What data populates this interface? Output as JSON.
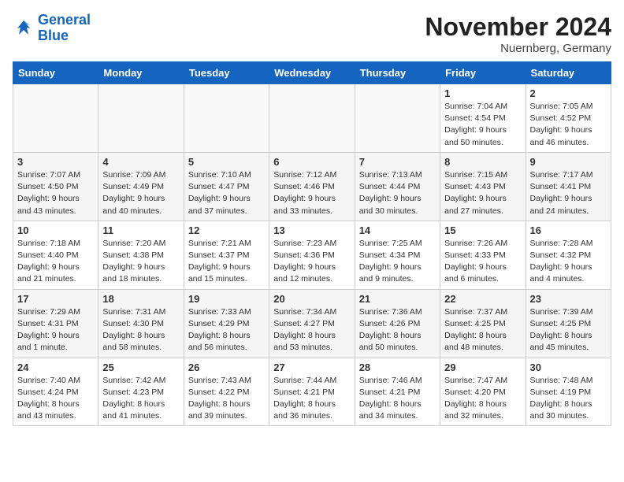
{
  "header": {
    "logo_line1": "General",
    "logo_line2": "Blue",
    "month_title": "November 2024",
    "location": "Nuernberg, Germany"
  },
  "weekdays": [
    "Sunday",
    "Monday",
    "Tuesday",
    "Wednesday",
    "Thursday",
    "Friday",
    "Saturday"
  ],
  "weeks": [
    [
      {
        "day": "",
        "info": ""
      },
      {
        "day": "",
        "info": ""
      },
      {
        "day": "",
        "info": ""
      },
      {
        "day": "",
        "info": ""
      },
      {
        "day": "",
        "info": ""
      },
      {
        "day": "1",
        "info": "Sunrise: 7:04 AM\nSunset: 4:54 PM\nDaylight: 9 hours\nand 50 minutes."
      },
      {
        "day": "2",
        "info": "Sunrise: 7:05 AM\nSunset: 4:52 PM\nDaylight: 9 hours\nand 46 minutes."
      }
    ],
    [
      {
        "day": "3",
        "info": "Sunrise: 7:07 AM\nSunset: 4:50 PM\nDaylight: 9 hours\nand 43 minutes."
      },
      {
        "day": "4",
        "info": "Sunrise: 7:09 AM\nSunset: 4:49 PM\nDaylight: 9 hours\nand 40 minutes."
      },
      {
        "day": "5",
        "info": "Sunrise: 7:10 AM\nSunset: 4:47 PM\nDaylight: 9 hours\nand 37 minutes."
      },
      {
        "day": "6",
        "info": "Sunrise: 7:12 AM\nSunset: 4:46 PM\nDaylight: 9 hours\nand 33 minutes."
      },
      {
        "day": "7",
        "info": "Sunrise: 7:13 AM\nSunset: 4:44 PM\nDaylight: 9 hours\nand 30 minutes."
      },
      {
        "day": "8",
        "info": "Sunrise: 7:15 AM\nSunset: 4:43 PM\nDaylight: 9 hours\nand 27 minutes."
      },
      {
        "day": "9",
        "info": "Sunrise: 7:17 AM\nSunset: 4:41 PM\nDaylight: 9 hours\nand 24 minutes."
      }
    ],
    [
      {
        "day": "10",
        "info": "Sunrise: 7:18 AM\nSunset: 4:40 PM\nDaylight: 9 hours\nand 21 minutes."
      },
      {
        "day": "11",
        "info": "Sunrise: 7:20 AM\nSunset: 4:38 PM\nDaylight: 9 hours\nand 18 minutes."
      },
      {
        "day": "12",
        "info": "Sunrise: 7:21 AM\nSunset: 4:37 PM\nDaylight: 9 hours\nand 15 minutes."
      },
      {
        "day": "13",
        "info": "Sunrise: 7:23 AM\nSunset: 4:36 PM\nDaylight: 9 hours\nand 12 minutes."
      },
      {
        "day": "14",
        "info": "Sunrise: 7:25 AM\nSunset: 4:34 PM\nDaylight: 9 hours\nand 9 minutes."
      },
      {
        "day": "15",
        "info": "Sunrise: 7:26 AM\nSunset: 4:33 PM\nDaylight: 9 hours\nand 6 minutes."
      },
      {
        "day": "16",
        "info": "Sunrise: 7:28 AM\nSunset: 4:32 PM\nDaylight: 9 hours\nand 4 minutes."
      }
    ],
    [
      {
        "day": "17",
        "info": "Sunrise: 7:29 AM\nSunset: 4:31 PM\nDaylight: 9 hours\nand 1 minute."
      },
      {
        "day": "18",
        "info": "Sunrise: 7:31 AM\nSunset: 4:30 PM\nDaylight: 8 hours\nand 58 minutes."
      },
      {
        "day": "19",
        "info": "Sunrise: 7:33 AM\nSunset: 4:29 PM\nDaylight: 8 hours\nand 56 minutes."
      },
      {
        "day": "20",
        "info": "Sunrise: 7:34 AM\nSunset: 4:27 PM\nDaylight: 8 hours\nand 53 minutes."
      },
      {
        "day": "21",
        "info": "Sunrise: 7:36 AM\nSunset: 4:26 PM\nDaylight: 8 hours\nand 50 minutes."
      },
      {
        "day": "22",
        "info": "Sunrise: 7:37 AM\nSunset: 4:25 PM\nDaylight: 8 hours\nand 48 minutes."
      },
      {
        "day": "23",
        "info": "Sunrise: 7:39 AM\nSunset: 4:25 PM\nDaylight: 8 hours\nand 45 minutes."
      }
    ],
    [
      {
        "day": "24",
        "info": "Sunrise: 7:40 AM\nSunset: 4:24 PM\nDaylight: 8 hours\nand 43 minutes."
      },
      {
        "day": "25",
        "info": "Sunrise: 7:42 AM\nSunset: 4:23 PM\nDaylight: 8 hours\nand 41 minutes."
      },
      {
        "day": "26",
        "info": "Sunrise: 7:43 AM\nSunset: 4:22 PM\nDaylight: 8 hours\nand 39 minutes."
      },
      {
        "day": "27",
        "info": "Sunrise: 7:44 AM\nSunset: 4:21 PM\nDaylight: 8 hours\nand 36 minutes."
      },
      {
        "day": "28",
        "info": "Sunrise: 7:46 AM\nSunset: 4:21 PM\nDaylight: 8 hours\nand 34 minutes."
      },
      {
        "day": "29",
        "info": "Sunrise: 7:47 AM\nSunset: 4:20 PM\nDaylight: 8 hours\nand 32 minutes."
      },
      {
        "day": "30",
        "info": "Sunrise: 7:48 AM\nSunset: 4:19 PM\nDaylight: 8 hours\nand 30 minutes."
      }
    ]
  ]
}
